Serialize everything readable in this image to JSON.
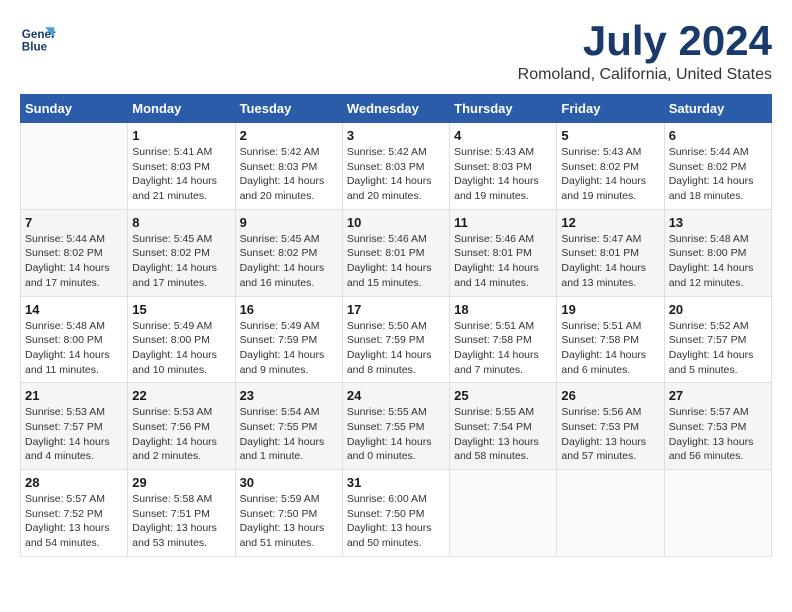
{
  "logo": {
    "line1": "General",
    "line2": "Blue"
  },
  "title": "July 2024",
  "subtitle": "Romoland, California, United States",
  "days_header": [
    "Sunday",
    "Monday",
    "Tuesday",
    "Wednesday",
    "Thursday",
    "Friday",
    "Saturday"
  ],
  "weeks": [
    [
      {
        "num": "",
        "info": ""
      },
      {
        "num": "1",
        "info": "Sunrise: 5:41 AM\nSunset: 8:03 PM\nDaylight: 14 hours\nand 21 minutes."
      },
      {
        "num": "2",
        "info": "Sunrise: 5:42 AM\nSunset: 8:03 PM\nDaylight: 14 hours\nand 20 minutes."
      },
      {
        "num": "3",
        "info": "Sunrise: 5:42 AM\nSunset: 8:03 PM\nDaylight: 14 hours\nand 20 minutes."
      },
      {
        "num": "4",
        "info": "Sunrise: 5:43 AM\nSunset: 8:03 PM\nDaylight: 14 hours\nand 19 minutes."
      },
      {
        "num": "5",
        "info": "Sunrise: 5:43 AM\nSunset: 8:02 PM\nDaylight: 14 hours\nand 19 minutes."
      },
      {
        "num": "6",
        "info": "Sunrise: 5:44 AM\nSunset: 8:02 PM\nDaylight: 14 hours\nand 18 minutes."
      }
    ],
    [
      {
        "num": "7",
        "info": "Sunrise: 5:44 AM\nSunset: 8:02 PM\nDaylight: 14 hours\nand 17 minutes."
      },
      {
        "num": "8",
        "info": "Sunrise: 5:45 AM\nSunset: 8:02 PM\nDaylight: 14 hours\nand 17 minutes."
      },
      {
        "num": "9",
        "info": "Sunrise: 5:45 AM\nSunset: 8:02 PM\nDaylight: 14 hours\nand 16 minutes."
      },
      {
        "num": "10",
        "info": "Sunrise: 5:46 AM\nSunset: 8:01 PM\nDaylight: 14 hours\nand 15 minutes."
      },
      {
        "num": "11",
        "info": "Sunrise: 5:46 AM\nSunset: 8:01 PM\nDaylight: 14 hours\nand 14 minutes."
      },
      {
        "num": "12",
        "info": "Sunrise: 5:47 AM\nSunset: 8:01 PM\nDaylight: 14 hours\nand 13 minutes."
      },
      {
        "num": "13",
        "info": "Sunrise: 5:48 AM\nSunset: 8:00 PM\nDaylight: 14 hours\nand 12 minutes."
      }
    ],
    [
      {
        "num": "14",
        "info": "Sunrise: 5:48 AM\nSunset: 8:00 PM\nDaylight: 14 hours\nand 11 minutes."
      },
      {
        "num": "15",
        "info": "Sunrise: 5:49 AM\nSunset: 8:00 PM\nDaylight: 14 hours\nand 10 minutes."
      },
      {
        "num": "16",
        "info": "Sunrise: 5:49 AM\nSunset: 7:59 PM\nDaylight: 14 hours\nand 9 minutes."
      },
      {
        "num": "17",
        "info": "Sunrise: 5:50 AM\nSunset: 7:59 PM\nDaylight: 14 hours\nand 8 minutes."
      },
      {
        "num": "18",
        "info": "Sunrise: 5:51 AM\nSunset: 7:58 PM\nDaylight: 14 hours\nand 7 minutes."
      },
      {
        "num": "19",
        "info": "Sunrise: 5:51 AM\nSunset: 7:58 PM\nDaylight: 14 hours\nand 6 minutes."
      },
      {
        "num": "20",
        "info": "Sunrise: 5:52 AM\nSunset: 7:57 PM\nDaylight: 14 hours\nand 5 minutes."
      }
    ],
    [
      {
        "num": "21",
        "info": "Sunrise: 5:53 AM\nSunset: 7:57 PM\nDaylight: 14 hours\nand 4 minutes."
      },
      {
        "num": "22",
        "info": "Sunrise: 5:53 AM\nSunset: 7:56 PM\nDaylight: 14 hours\nand 2 minutes."
      },
      {
        "num": "23",
        "info": "Sunrise: 5:54 AM\nSunset: 7:55 PM\nDaylight: 14 hours\nand 1 minute."
      },
      {
        "num": "24",
        "info": "Sunrise: 5:55 AM\nSunset: 7:55 PM\nDaylight: 14 hours\nand 0 minutes."
      },
      {
        "num": "25",
        "info": "Sunrise: 5:55 AM\nSunset: 7:54 PM\nDaylight: 13 hours\nand 58 minutes."
      },
      {
        "num": "26",
        "info": "Sunrise: 5:56 AM\nSunset: 7:53 PM\nDaylight: 13 hours\nand 57 minutes."
      },
      {
        "num": "27",
        "info": "Sunrise: 5:57 AM\nSunset: 7:53 PM\nDaylight: 13 hours\nand 56 minutes."
      }
    ],
    [
      {
        "num": "28",
        "info": "Sunrise: 5:57 AM\nSunset: 7:52 PM\nDaylight: 13 hours\nand 54 minutes."
      },
      {
        "num": "29",
        "info": "Sunrise: 5:58 AM\nSunset: 7:51 PM\nDaylight: 13 hours\nand 53 minutes."
      },
      {
        "num": "30",
        "info": "Sunrise: 5:59 AM\nSunset: 7:50 PM\nDaylight: 13 hours\nand 51 minutes."
      },
      {
        "num": "31",
        "info": "Sunrise: 6:00 AM\nSunset: 7:50 PM\nDaylight: 13 hours\nand 50 minutes."
      },
      {
        "num": "",
        "info": ""
      },
      {
        "num": "",
        "info": ""
      },
      {
        "num": "",
        "info": ""
      }
    ]
  ]
}
